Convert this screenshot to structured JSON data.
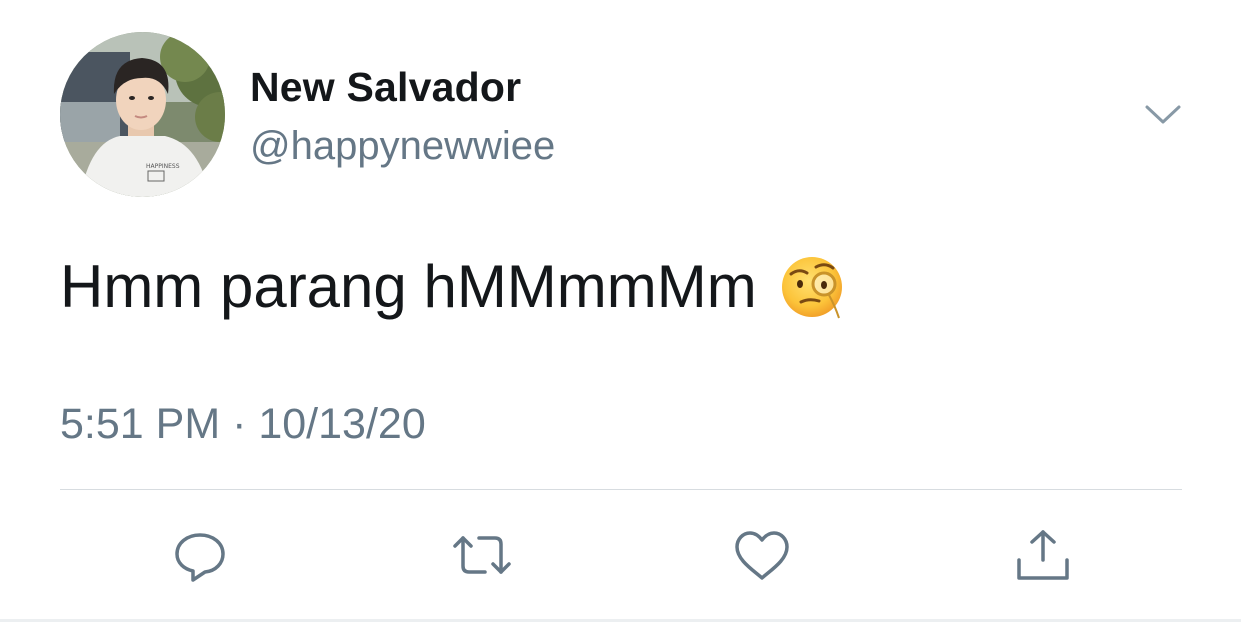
{
  "author": {
    "display_name": "New Salvador",
    "handle": "@happynewwiee",
    "avatar_shirt_text": "HAPPINESS"
  },
  "tweet": {
    "text": "Hmm parang hMMmmMm",
    "emoji": "face-with-monocle",
    "timestamp": "5:51 PM · 10/13/20"
  },
  "actions": [
    "reply-icon",
    "retweet-icon",
    "like-icon",
    "share-icon"
  ],
  "colors": {
    "text_primary": "#14171a",
    "text_secondary": "#657786",
    "icon": "#657786",
    "divider": "#d7dce0"
  }
}
